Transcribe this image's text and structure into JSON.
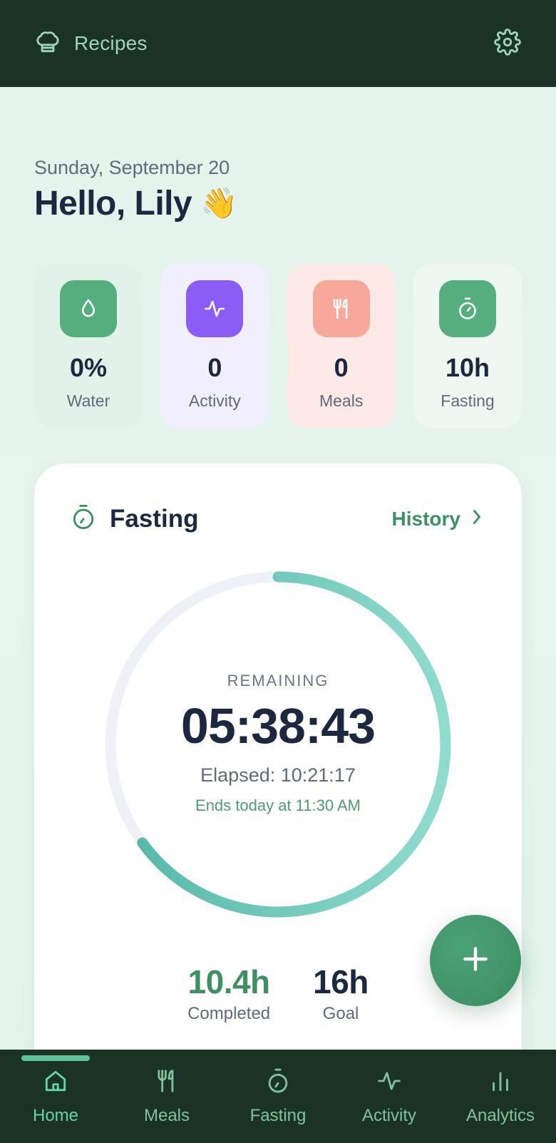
{
  "header": {
    "brand_label": "Recipes",
    "brand_icon": "chef-hat-icon",
    "settings_icon": "gear-icon"
  },
  "greeting": {
    "date": "Sunday, September 20",
    "text": "Hello, Lily",
    "emoji": "👋"
  },
  "stats": [
    {
      "id": "water",
      "value": "0%",
      "label": "Water",
      "icon": "droplet-icon",
      "icon_bg": "#55ae7e"
    },
    {
      "id": "activity",
      "value": "0",
      "label": "Activity",
      "icon": "pulse-icon",
      "icon_bg": "#8b5cf6"
    },
    {
      "id": "meals",
      "value": "0",
      "label": "Meals",
      "icon": "utensils-icon",
      "icon_bg": "#f6a99a"
    },
    {
      "id": "fasting",
      "value": "10h",
      "label": "Fasting",
      "icon": "timer-icon",
      "icon_bg": "#55ae7e"
    }
  ],
  "fasting_card": {
    "title": "Fasting",
    "history_label": "History",
    "remaining_label": "REMAINING",
    "remaining_time": "05:38:43",
    "elapsed": "Elapsed: 10:21:17",
    "ends": "Ends today at 11:30 AM",
    "progress_fraction": 0.65,
    "completed_value": "10.4h",
    "completed_label": "Completed",
    "goal_value": "16h",
    "goal_label": "Goal"
  },
  "fab": {
    "icon": "plus-icon"
  },
  "nav": {
    "items": [
      {
        "label": "Home",
        "icon": "home-icon",
        "active": true
      },
      {
        "label": "Meals",
        "icon": "utensils-icon",
        "active": false
      },
      {
        "label": "Fasting",
        "icon": "timer-icon",
        "active": false
      },
      {
        "label": "Activity",
        "icon": "pulse-icon",
        "active": false
      },
      {
        "label": "Analytics",
        "icon": "bar-chart-icon",
        "active": false
      }
    ]
  },
  "colors": {
    "header_bg": "#1b3325",
    "accent_green": "#3f8f64",
    "ring_start": "#5bbfae",
    "ring_end": "#8fdccf",
    "ring_track": "#eef2f8"
  }
}
